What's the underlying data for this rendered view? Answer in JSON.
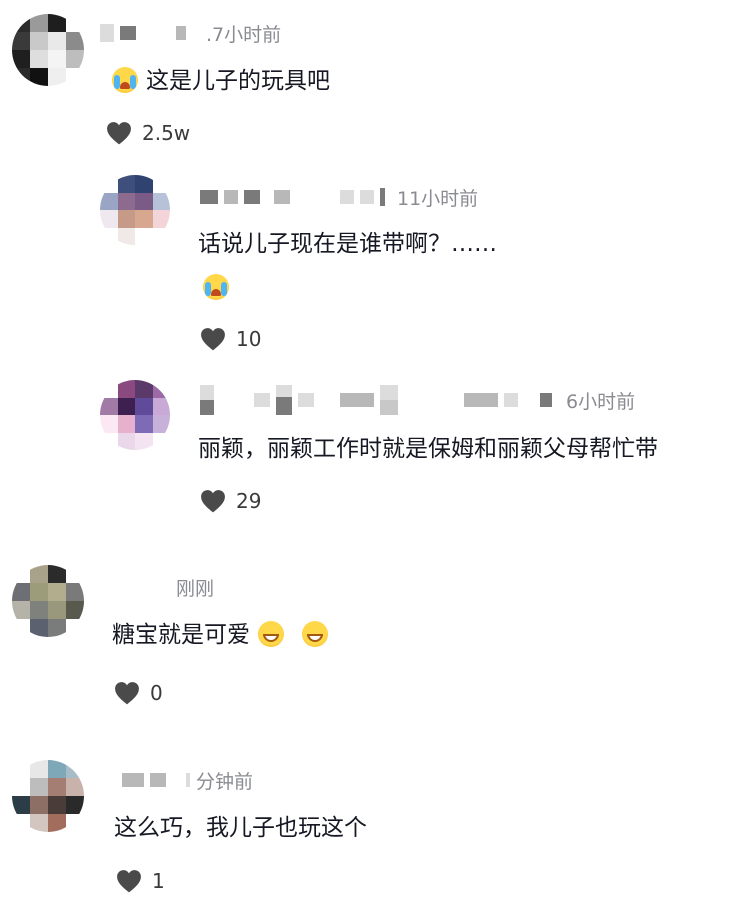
{
  "comments": [
    {
      "time": ".7小时前",
      "text": "这是儿子的玩具吧",
      "emoji": "laughing-crying-emoji",
      "likes": "2.5w"
    },
    {
      "time": "11小时前",
      "text": "话说儿子现在是谁带啊？……",
      "emoji": "crying-emoji",
      "likes": "10"
    },
    {
      "time": "6小时前",
      "text": "丽颖，丽颖工作时就是保姆和丽颖父母帮忙带",
      "likes": "29"
    },
    {
      "time": "刚刚",
      "text": "糖宝就是可爱",
      "emoji": "grinning-emoji",
      "likes": "0"
    },
    {
      "time": "分钟前",
      "text": "这么巧，我儿子也玩这个",
      "likes": "1"
    }
  ],
  "colors": {
    "text": "#161823",
    "secondary": "#8a8b91",
    "heart": "#4a4a4a"
  }
}
